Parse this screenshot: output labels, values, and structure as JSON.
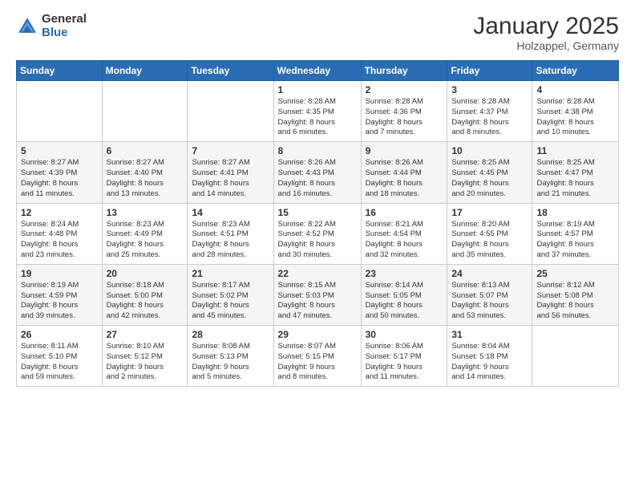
{
  "logo": {
    "general": "General",
    "blue": "Blue"
  },
  "title": "January 2025",
  "subtitle": "Holzappel, Germany",
  "weekdays": [
    "Sunday",
    "Monday",
    "Tuesday",
    "Wednesday",
    "Thursday",
    "Friday",
    "Saturday"
  ],
  "weeks": [
    [
      {
        "day": "",
        "detail": ""
      },
      {
        "day": "",
        "detail": ""
      },
      {
        "day": "",
        "detail": ""
      },
      {
        "day": "1",
        "detail": "Sunrise: 8:28 AM\nSunset: 4:35 PM\nDaylight: 8 hours\nand 6 minutes."
      },
      {
        "day": "2",
        "detail": "Sunrise: 8:28 AM\nSunset: 4:36 PM\nDaylight: 8 hours\nand 7 minutes."
      },
      {
        "day": "3",
        "detail": "Sunrise: 8:28 AM\nSunset: 4:37 PM\nDaylight: 8 hours\nand 8 minutes."
      },
      {
        "day": "4",
        "detail": "Sunrise: 8:28 AM\nSunset: 4:38 PM\nDaylight: 8 hours\nand 10 minutes."
      }
    ],
    [
      {
        "day": "5",
        "detail": "Sunrise: 8:27 AM\nSunset: 4:39 PM\nDaylight: 8 hours\nand 11 minutes."
      },
      {
        "day": "6",
        "detail": "Sunrise: 8:27 AM\nSunset: 4:40 PM\nDaylight: 8 hours\nand 13 minutes."
      },
      {
        "day": "7",
        "detail": "Sunrise: 8:27 AM\nSunset: 4:41 PM\nDaylight: 8 hours\nand 14 minutes."
      },
      {
        "day": "8",
        "detail": "Sunrise: 8:26 AM\nSunset: 4:43 PM\nDaylight: 8 hours\nand 16 minutes."
      },
      {
        "day": "9",
        "detail": "Sunrise: 8:26 AM\nSunset: 4:44 PM\nDaylight: 8 hours\nand 18 minutes."
      },
      {
        "day": "10",
        "detail": "Sunrise: 8:25 AM\nSunset: 4:45 PM\nDaylight: 8 hours\nand 20 minutes."
      },
      {
        "day": "11",
        "detail": "Sunrise: 8:25 AM\nSunset: 4:47 PM\nDaylight: 8 hours\nand 21 minutes."
      }
    ],
    [
      {
        "day": "12",
        "detail": "Sunrise: 8:24 AM\nSunset: 4:48 PM\nDaylight: 8 hours\nand 23 minutes."
      },
      {
        "day": "13",
        "detail": "Sunrise: 8:23 AM\nSunset: 4:49 PM\nDaylight: 8 hours\nand 25 minutes."
      },
      {
        "day": "14",
        "detail": "Sunrise: 8:23 AM\nSunset: 4:51 PM\nDaylight: 8 hours\nand 28 minutes."
      },
      {
        "day": "15",
        "detail": "Sunrise: 8:22 AM\nSunset: 4:52 PM\nDaylight: 8 hours\nand 30 minutes."
      },
      {
        "day": "16",
        "detail": "Sunrise: 8:21 AM\nSunset: 4:54 PM\nDaylight: 8 hours\nand 32 minutes."
      },
      {
        "day": "17",
        "detail": "Sunrise: 8:20 AM\nSunset: 4:55 PM\nDaylight: 8 hours\nand 35 minutes."
      },
      {
        "day": "18",
        "detail": "Sunrise: 8:19 AM\nSunset: 4:57 PM\nDaylight: 8 hours\nand 37 minutes."
      }
    ],
    [
      {
        "day": "19",
        "detail": "Sunrise: 8:19 AM\nSunset: 4:59 PM\nDaylight: 8 hours\nand 39 minutes."
      },
      {
        "day": "20",
        "detail": "Sunrise: 8:18 AM\nSunset: 5:00 PM\nDaylight: 8 hours\nand 42 minutes."
      },
      {
        "day": "21",
        "detail": "Sunrise: 8:17 AM\nSunset: 5:02 PM\nDaylight: 8 hours\nand 45 minutes."
      },
      {
        "day": "22",
        "detail": "Sunrise: 8:15 AM\nSunset: 5:03 PM\nDaylight: 8 hours\nand 47 minutes."
      },
      {
        "day": "23",
        "detail": "Sunrise: 8:14 AM\nSunset: 5:05 PM\nDaylight: 8 hours\nand 50 minutes."
      },
      {
        "day": "24",
        "detail": "Sunrise: 8:13 AM\nSunset: 5:07 PM\nDaylight: 8 hours\nand 53 minutes."
      },
      {
        "day": "25",
        "detail": "Sunrise: 8:12 AM\nSunset: 5:08 PM\nDaylight: 8 hours\nand 56 minutes."
      }
    ],
    [
      {
        "day": "26",
        "detail": "Sunrise: 8:11 AM\nSunset: 5:10 PM\nDaylight: 8 hours\nand 59 minutes."
      },
      {
        "day": "27",
        "detail": "Sunrise: 8:10 AM\nSunset: 5:12 PM\nDaylight: 9 hours\nand 2 minutes."
      },
      {
        "day": "28",
        "detail": "Sunrise: 8:08 AM\nSunset: 5:13 PM\nDaylight: 9 hours\nand 5 minutes."
      },
      {
        "day": "29",
        "detail": "Sunrise: 8:07 AM\nSunset: 5:15 PM\nDaylight: 9 hours\nand 8 minutes."
      },
      {
        "day": "30",
        "detail": "Sunrise: 8:06 AM\nSunset: 5:17 PM\nDaylight: 9 hours\nand 11 minutes."
      },
      {
        "day": "31",
        "detail": "Sunrise: 8:04 AM\nSunset: 5:18 PM\nDaylight: 9 hours\nand 14 minutes."
      },
      {
        "day": "",
        "detail": ""
      }
    ]
  ]
}
